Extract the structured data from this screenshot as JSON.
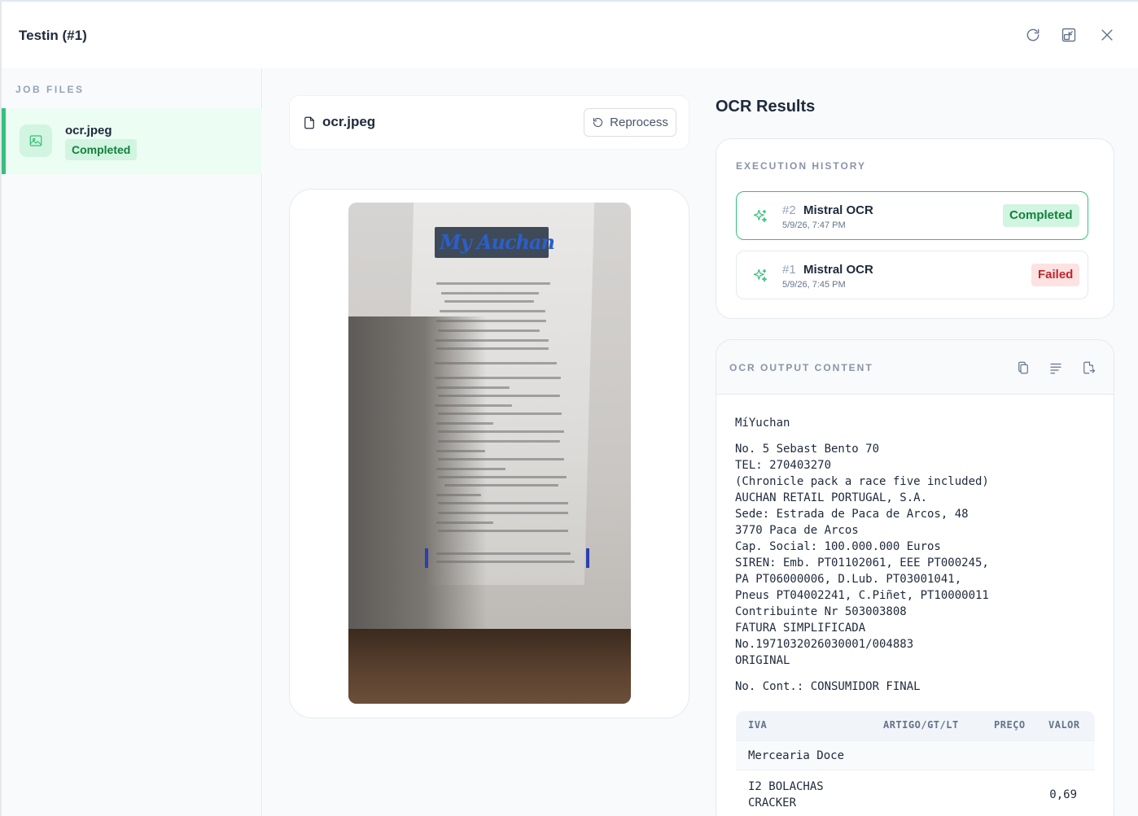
{
  "window": {
    "title": "Testin (#1)"
  },
  "header_actions": {
    "refresh_icon": "refresh-icon",
    "restore_icon": "restore-window-icon",
    "close_icon": "close-icon"
  },
  "sidebar": {
    "heading": "JOB FILES",
    "files": [
      {
        "name": "ocr.jpeg",
        "status": "Completed",
        "icon": "image-icon"
      }
    ]
  },
  "viewer": {
    "file_name": "ocr.jpeg",
    "reprocess_label": "Reprocess"
  },
  "results": {
    "title": "OCR Results",
    "history_heading": "EXECUTION HISTORY",
    "executions": [
      {
        "num": "#2",
        "name": "Mistral OCR",
        "time": "5/9/26, 7:47 PM",
        "status": "Completed"
      },
      {
        "num": "#1",
        "name": "Mistral OCR",
        "time": "5/9/26, 7:45 PM",
        "status": "Failed"
      }
    ],
    "output_heading": "OCR OUTPUT CONTENT",
    "output_lines": [
      "MíYuchan",
      "",
      "No. 5 Sebast Bento 70",
      "TEL: 270403270",
      "(Chronicle pack a race five included)",
      "AUCHAN RETAIL PORTUGAL, S.A.",
      "Sede: Estrada de Paca de Arcos, 48",
      "3770 Paca de Arcos",
      "Cap. Social: 100.000.000 Euros",
      "SIREN: Emb. PT01102061, EEE PT000245,",
      "PA PT06000006, D.Lub. PT03001041,",
      "Pneus PT04002241, C.Piñet, PT10000011",
      "Contribuinte Nr 503003808",
      "FATURA SIMPLIFICADA",
      "No.1971032026030001/004883",
      "ORIGINAL",
      "",
      "No. Cont.: CONSUMIDOR FINAL"
    ],
    "table": {
      "headers": [
        "IVA",
        "ARTIGO/GT/LT",
        "PREÇO",
        "VALOR"
      ],
      "rows": [
        {
          "iva": "Mercearia Doce",
          "valor": ""
        },
        {
          "iva": "I2 BOLACHAS CRACKER",
          "valor": "0,69"
        }
      ]
    }
  }
}
